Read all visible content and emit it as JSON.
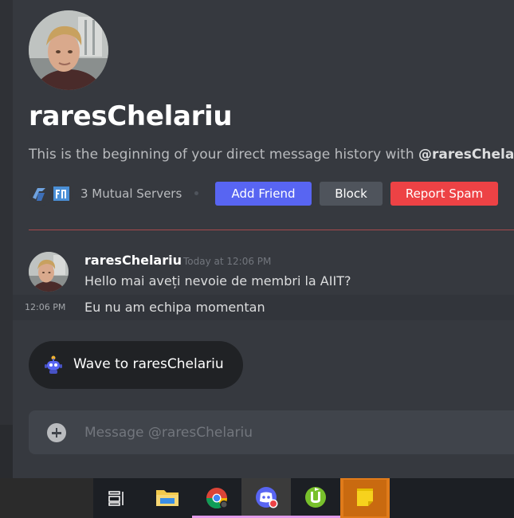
{
  "profile": {
    "name": "raresChelariu",
    "intro_prefix": "This is the beginning of your direct message history with ",
    "intro_handle": "@raresChelariu",
    "intro_suffix": ".",
    "mutual_servers": "3 Mutual Servers"
  },
  "actions": {
    "add_friend": "Add Friend",
    "block": "Block",
    "report_spam": "Report Spam"
  },
  "messages": [
    {
      "author": "raresChelariu",
      "timestamp": "Today at 12:06 PM",
      "text": "Hello mai aveți nevoie de membri la AIIT?"
    },
    {
      "timestamp": "12:06 PM",
      "text": "Eu nu am echipa momentan"
    }
  ],
  "wave": {
    "label": "Wave to raresChelariu"
  },
  "composer": {
    "placeholder": "Message @raresChelariu"
  },
  "colors": {
    "background": "#36393f",
    "blurple": "#5865f2",
    "danger": "#ed4245",
    "secondary": "#4f545c"
  },
  "taskbar": {
    "items": [
      "task-view-icon",
      "file-explorer-icon",
      "chrome-icon",
      "discord-icon",
      "utorrent-icon",
      "sticky-notes-icon"
    ]
  }
}
